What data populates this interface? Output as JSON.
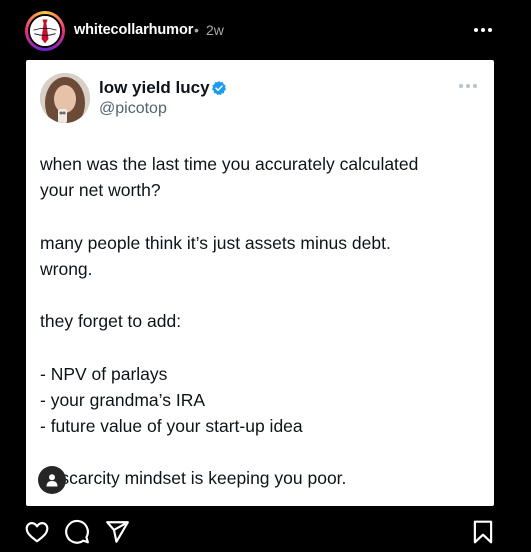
{
  "post_header": {
    "username": "whitecollarhumor",
    "separator": "•",
    "timestamp": "2w",
    "avatar_icon": "red-tie-logo-icon",
    "more_icon": "more-horizontal-icon"
  },
  "tweet": {
    "display_name": "low yield lucy",
    "handle": "@picotop",
    "verified_icon": "verified-badge-icon",
    "verified_color": "#1d9bf0",
    "lines": [
      "when was the last time you accurately calculated",
      "your net worth?",
      "",
      "many people think it’s just assets minus debt.",
      "wrong.",
      "",
      "they forget to add:",
      "",
      "- NPV of parlays",
      "- your grandma’s IRA",
      "- future value of your start-up idea",
      "",
      "ur scarcity mindset is keeping you poor."
    ]
  },
  "tag_icon": "person-tag-icon",
  "actions": {
    "like_icon": "heart-icon",
    "comment_icon": "comment-bubble-icon",
    "share_icon": "paper-plane-icon",
    "save_icon": "bookmark-icon"
  },
  "colors": {
    "background": "#000000",
    "text_primary": "#0f1419",
    "text_secondary": "#536471",
    "meta_gray": "#a8a8a8"
  }
}
